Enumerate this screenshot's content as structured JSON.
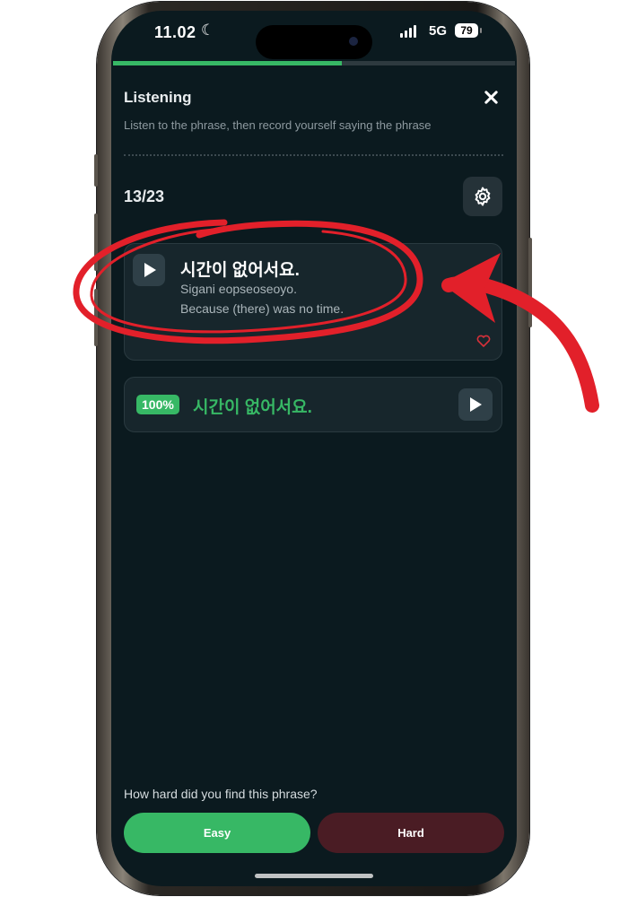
{
  "status_bar": {
    "time": "11.02",
    "moon_glyph": "☾",
    "network": "5G",
    "battery": "79"
  },
  "progress": {
    "fraction": 0.57,
    "accent": "#37b865"
  },
  "header": {
    "title": "Listening",
    "instruction": "Listen to the phrase, then record yourself saying the phrase"
  },
  "counter": "13/23",
  "phrase": {
    "korean": "시간이 없어서요.",
    "romanization": "Sigani eopseoseoyo.",
    "english": "Because (there) was no time."
  },
  "result": {
    "score": "100%",
    "text": "시간이 없어서요.",
    "color": "#37b865"
  },
  "feedback": {
    "question": "How hard did you find this phrase?",
    "easy_label": "Easy",
    "hard_label": "Hard"
  },
  "annotation": {
    "color": "#e2202a"
  },
  "icons": [
    "moon-icon",
    "signal-icon",
    "battery-icon",
    "close-icon",
    "gear-icon",
    "play-icon",
    "heart-icon"
  ]
}
